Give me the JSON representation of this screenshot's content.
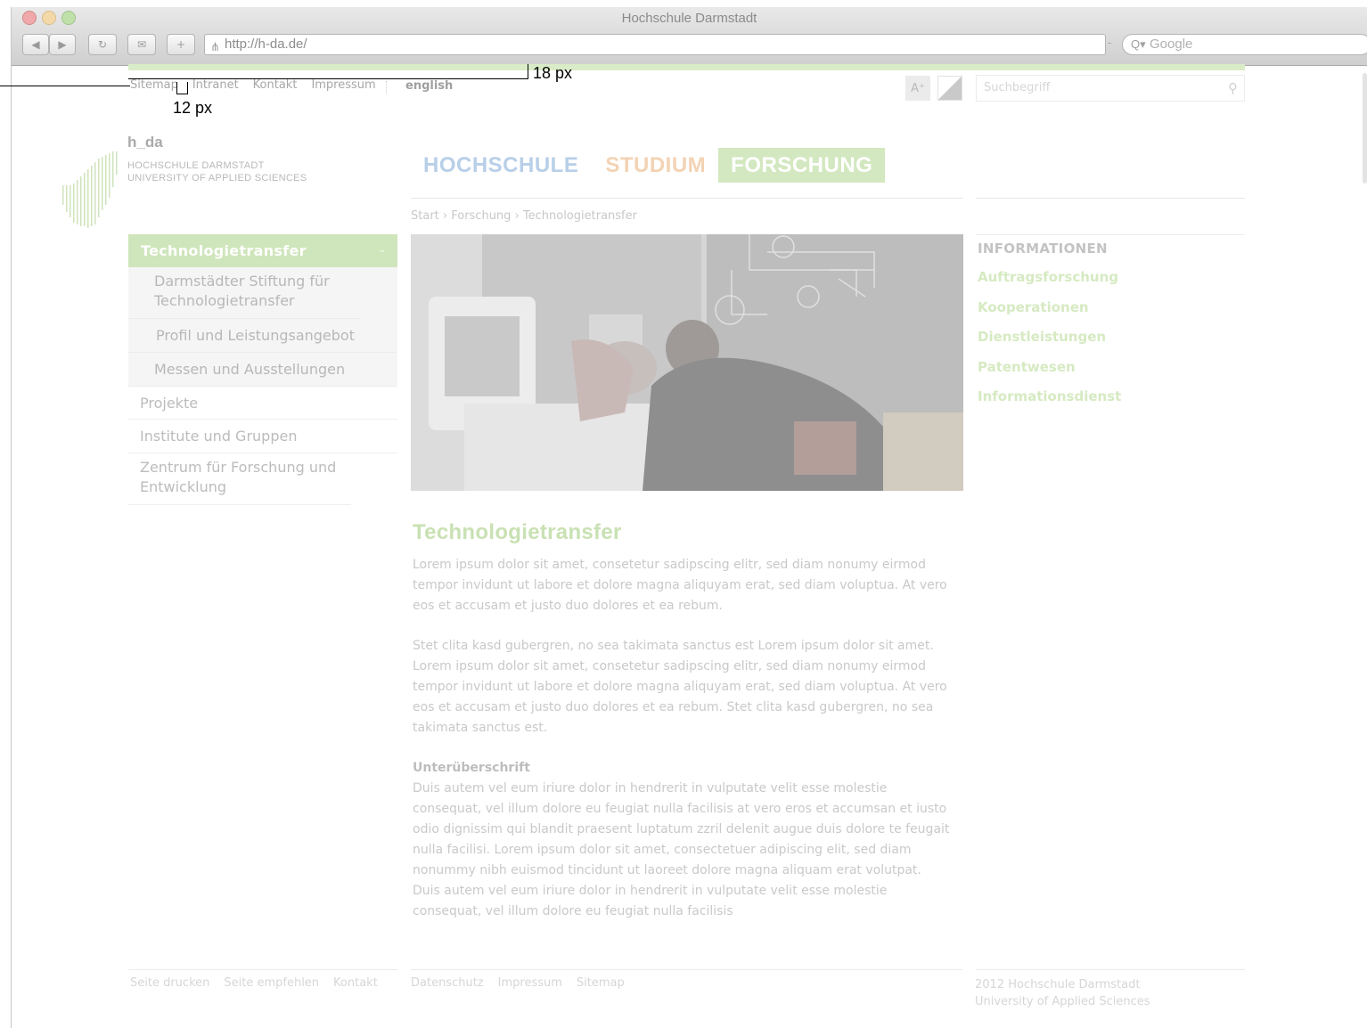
{
  "browser": {
    "window_title": "Hochschule Darmstadt",
    "url": "http://h-da.de/",
    "search_placeholder": "Google"
  },
  "meta_nav": [
    "Sitemap",
    "Intranet",
    "Kontakt",
    "Impressum"
  ],
  "language_link": "english",
  "tools": {
    "font_size_label": "A⁺"
  },
  "page_search": {
    "placeholder": "Suchbegriff"
  },
  "logo": {
    "title": "h_da",
    "line1": "HOCHSCHULE DARMSTADT",
    "line2": "UNIVERSITY OF APPLIED SCIENCES"
  },
  "main_nav": {
    "items": [
      "HOCHSCHULE",
      "STUDIUM",
      "FORSCHUNG"
    ],
    "active": "FORSCHUNG",
    "colors": {
      "hochschule": "#b8cfe8",
      "studium": "#f3d3b4",
      "forschung": "#d3e8c0"
    }
  },
  "breadcrumb": "Start › Forschung › Technologietransfer",
  "sub_nav": {
    "active": "Technologietransfer",
    "children": [
      "Darmstädter Stiftung für Technologietransfer",
      "Profil und Leistungsangebot",
      "Messen und Ausstellungen"
    ],
    "items": [
      "Projekte",
      "Institute und Gruppen",
      "Zentrum für Forschung und Entwicklung"
    ]
  },
  "article": {
    "title": "Technologietransfer",
    "p1": "Lorem ipsum dolor sit amet, consetetur sadipscing elitr, sed diam nonumy eirmod tempor invidunt ut labore et dolore magna aliquyam erat, sed diam voluptua. At vero eos et accusam et justo duo dolores et ea rebum.",
    "p2": "Stet clita kasd gubergren, no sea takimata sanctus est Lorem ipsum dolor sit amet. Lorem ipsum dolor sit amet, consetetur sadipscing elitr, sed diam nonumy eirmod tempor invidunt ut labore et dolore magna aliquyam erat, sed diam voluptua. At vero eos et accusam et justo duo dolores et ea rebum. Stet clita kasd gubergren, no sea takimata sanctus est.",
    "subheading": "Unterüberschrift",
    "p3": "Duis autem vel eum iriure dolor in hendrerit in vulputate velit esse molestie consequat, vel illum dolore eu feugiat nulla facilisis at vero eros et accumsan et iusto odio dignissim qui blandit praesent luptatum zzril delenit augue duis dolore te feugait nulla facilisi. Lorem ipsum dolor sit amet, consectetuer adipiscing elit, sed diam nonummy nibh euismod tincidunt ut laoreet dolore magna aliquam erat volutpat. Duis autem vel eum iriure dolor in hendrerit in vulputate velit esse molestie consequat, vel illum dolore eu feugiat nulla facilisis"
  },
  "sidebar": {
    "heading": "INFORMATIONEN",
    "links": [
      "Auftragsforschung",
      "Kooperationen",
      "Dienstleistungen",
      "Patentwesen",
      "Informationsdienst"
    ]
  },
  "footer": {
    "left": [
      "Seite drucken",
      "Seite empfehlen",
      "Kontakt"
    ],
    "middle": [
      "Datenschutz",
      "Impressum",
      "Sitemap"
    ],
    "copyright_1": "2012 Hochschule Darmstadt",
    "copyright_2": "University of Applied Sciences"
  },
  "annotations": {
    "top_spacing": "18 px",
    "link_spacing": "12 px"
  },
  "colors": {
    "accent_green": "#8cc63f",
    "accent_blue": "#0a64b4",
    "accent_orange": "#f08c1e"
  }
}
